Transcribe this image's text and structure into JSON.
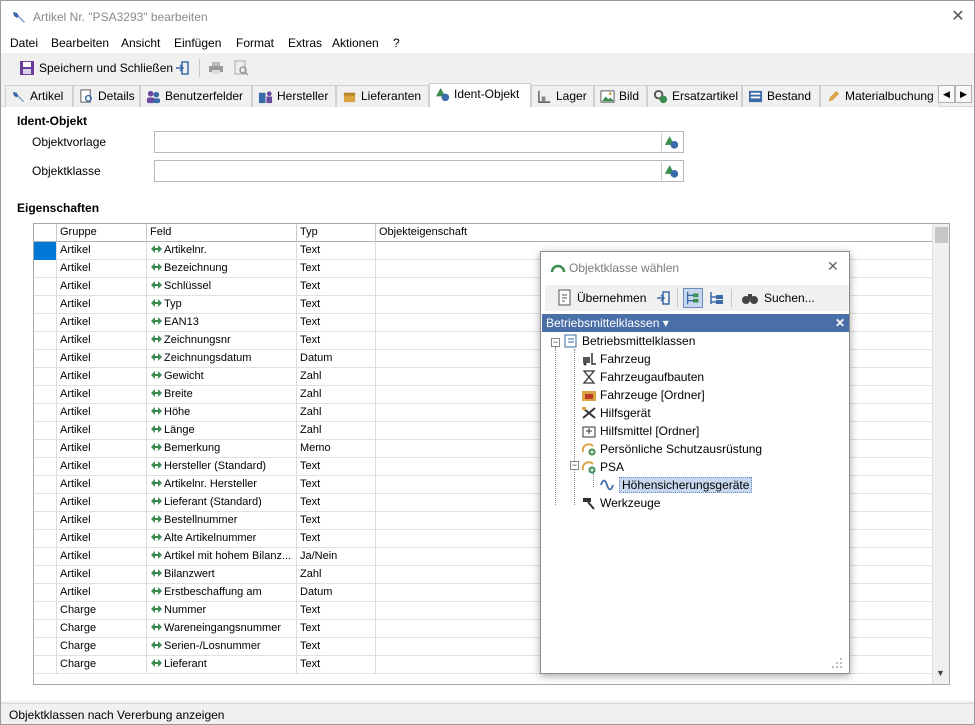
{
  "window": {
    "title": "Artikel Nr. \"PSA3293\" bearbeiten"
  },
  "menu": [
    "Datei",
    "Bearbeiten",
    "Ansicht",
    "Einfügen",
    "Format",
    "Extras",
    "Aktionen",
    "?"
  ],
  "toolbar": {
    "save_close_label": "Speichern und Schließen"
  },
  "tabs": [
    "Artikel",
    "Details",
    "Benutzerfelder",
    "Hersteller",
    "Lieferanten",
    "Ident-Objekt",
    "Lager",
    "Bild",
    "Ersatzartikel",
    "Bestand",
    "Materialbuchung"
  ],
  "ident": {
    "section": "Ident-Objekt",
    "objektvorlage_label": "Objektvorlage",
    "objektvorlage_value": "",
    "objektklasse_label": "Objektklasse",
    "objektklasse_value": ""
  },
  "eigenschaften": {
    "section": "Eigenschaften",
    "columns": [
      "Gruppe",
      "Feld",
      "Typ",
      "Objekteigenschaft"
    ],
    "rows": [
      [
        "Artikel",
        "Artikelnr.",
        "Text",
        ""
      ],
      [
        "Artikel",
        "Bezeichnung",
        "Text",
        ""
      ],
      [
        "Artikel",
        "Schlüssel",
        "Text",
        ""
      ],
      [
        "Artikel",
        "Typ",
        "Text",
        ""
      ],
      [
        "Artikel",
        "EAN13",
        "Text",
        ""
      ],
      [
        "Artikel",
        "Zeichnungsnr",
        "Text",
        ""
      ],
      [
        "Artikel",
        "Zeichnungsdatum",
        "Datum",
        ""
      ],
      [
        "Artikel",
        "Gewicht",
        "Zahl",
        ""
      ],
      [
        "Artikel",
        "Breite",
        "Zahl",
        ""
      ],
      [
        "Artikel",
        "Höhe",
        "Zahl",
        ""
      ],
      [
        "Artikel",
        "Länge",
        "Zahl",
        ""
      ],
      [
        "Artikel",
        "Bemerkung",
        "Memo",
        ""
      ],
      [
        "Artikel",
        "Hersteller (Standard)",
        "Text",
        ""
      ],
      [
        "Artikel",
        "Artikelnr. Hersteller",
        "Text",
        ""
      ],
      [
        "Artikel",
        "Lieferant (Standard)",
        "Text",
        ""
      ],
      [
        "Artikel",
        "Bestellnummer",
        "Text",
        ""
      ],
      [
        "Artikel",
        "Alte Artikelnummer",
        "Text",
        ""
      ],
      [
        "Artikel",
        "Artikel mit hohem Bilanz...",
        "Ja/Nein",
        ""
      ],
      [
        "Artikel",
        "Bilanzwert",
        "Zahl",
        ""
      ],
      [
        "Artikel",
        "Erstbeschaffung am",
        "Datum",
        ""
      ],
      [
        "Charge",
        "Nummer",
        "Text",
        ""
      ],
      [
        "Charge",
        "Wareneingangsnummer",
        "Text",
        ""
      ],
      [
        "Charge",
        "Serien-/Losnummer",
        "Text",
        ""
      ],
      [
        "Charge",
        "Lieferant",
        "Text",
        ""
      ]
    ]
  },
  "status": "Objektklassen nach Vererbung anzeigen",
  "dialog": {
    "title": "Objektklasse wählen",
    "apply_label": "Übernehmen",
    "search_label": "Suchen...",
    "header": "Betriebsmittelklassen ▾",
    "tree_root": "Betriebsmittelklassen",
    "tree_items": [
      "Fahrzeug",
      "Fahrzeugaufbauten",
      "Fahrzeuge [Ordner]",
      "Hilfsgerät",
      "Hilfsmittel [Ordner]",
      "Persönliche Schutzausrüstung",
      "PSA"
    ],
    "tree_psa_child": "Höhensicherungsgeräte",
    "tree_last": "Werkzeuge"
  },
  "colors": {
    "accent": "#4a6fa8",
    "selection": "#0078d7",
    "field_icon": "#3a8c4f"
  }
}
